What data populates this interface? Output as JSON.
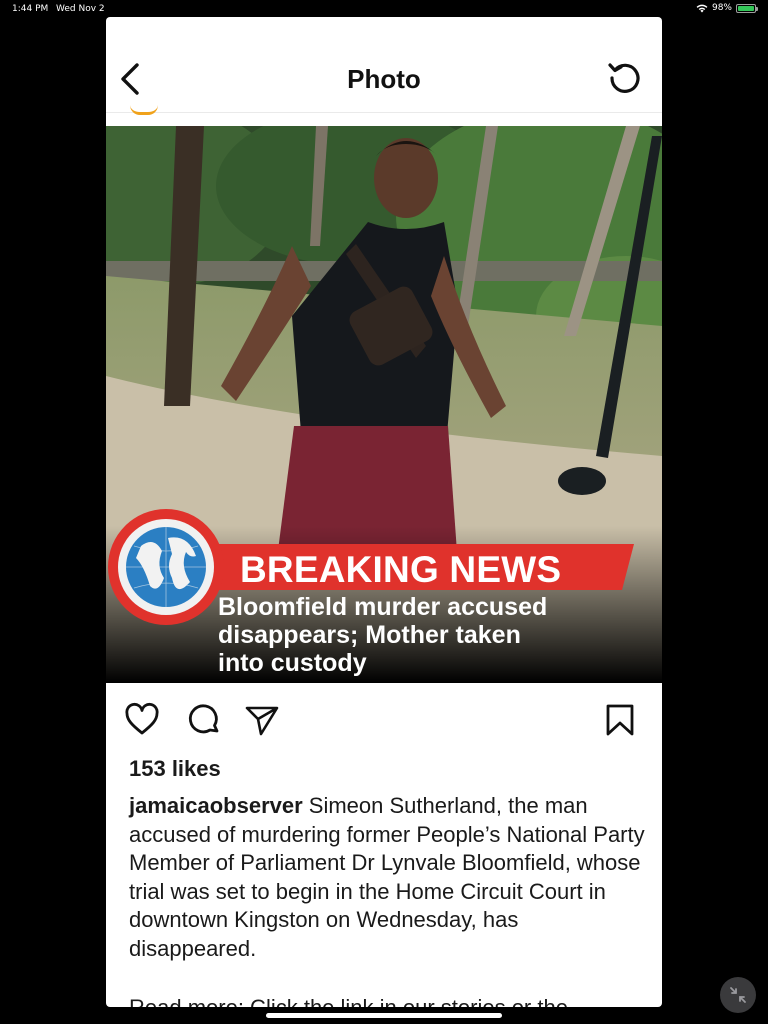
{
  "status_bar": {
    "time": "1:44 PM",
    "date": "Wed Nov 2",
    "battery": "98%",
    "battery_level": 0.98
  },
  "header": {
    "title": "Photo",
    "back_icon": "chevron-left-icon",
    "refresh_icon": "refresh-icon"
  },
  "post_image": {
    "banner": "BREAKING NEWS",
    "headline_lines": [
      "Bloomfield murder accused",
      "disappears; Mother taken",
      "into custody"
    ],
    "globe_icon": "globe-icon"
  },
  "actions": {
    "like_icon": "heart-icon",
    "comment_icon": "comment-icon",
    "share_icon": "send-icon",
    "save_icon": "bookmark-icon"
  },
  "likes": "153 likes",
  "caption": {
    "username": "jamaicaobserver",
    "text": " Simeon Sutherland, the man accused of murdering former People’s National Party Member of Parliament Dr Lynvale Bloomfield, whose trial was set to begin in the Home Circuit Court in downtown Kingston on Wednesday, has disappeared.",
    "read_more": "Read more: Click the link in our stories or the"
  },
  "colors": {
    "banner_red": "#e0322c",
    "accent_gold": "#f0a21b"
  }
}
